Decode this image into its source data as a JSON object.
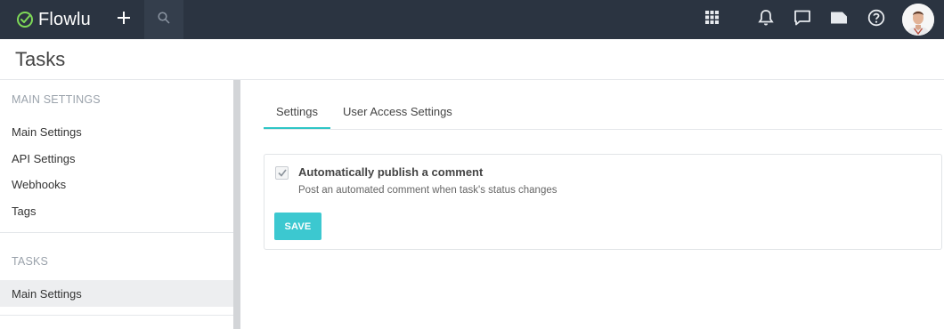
{
  "topbar": {
    "brand": "Flowlu",
    "icons": [
      "flowlu-logo-icon",
      "plus-icon",
      "search-icon",
      "apps-grid-icon",
      "bell-icon",
      "chat-icon",
      "tag-icon",
      "help-icon",
      "avatar"
    ],
    "colors": {
      "bar": "#2b3441",
      "search_bg": "#343e4c",
      "logo_green": "#7ed957"
    }
  },
  "page": {
    "title": "Tasks"
  },
  "sidebar": {
    "sections": [
      {
        "title": "MAIN SETTINGS",
        "items": [
          "Main Settings",
          "API Settings",
          "Webhooks",
          "Tags"
        ]
      },
      {
        "title": "TASKS",
        "items": [
          "Main Settings"
        ],
        "active_index": 0
      }
    ]
  },
  "tabs": [
    {
      "label": "Settings",
      "active": true
    },
    {
      "label": "User Access Settings",
      "active": false
    }
  ],
  "settings": {
    "option_label": "Automatically publish a comment",
    "option_desc": "Post an automated comment when task's status changes",
    "option_checked": true,
    "save_label": "SAVE"
  },
  "accent_color": "#2fc6c6"
}
